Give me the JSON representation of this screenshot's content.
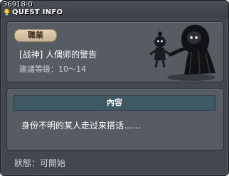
{
  "header": {
    "quest_id": "36918-0",
    "title": "QUEST INFO"
  },
  "quest": {
    "job_tab": "職業",
    "name": "[战神] 人偶师的警告",
    "level_range": "建議等级：10～14"
  },
  "content": {
    "header": "內容",
    "text": "身份不明的某人走过来搭话……"
  },
  "status": {
    "text": "狀態：可開始"
  },
  "icons": {
    "title_icon": "lightbulb-icon",
    "npc": "puppeteer-npc-portrait"
  }
}
